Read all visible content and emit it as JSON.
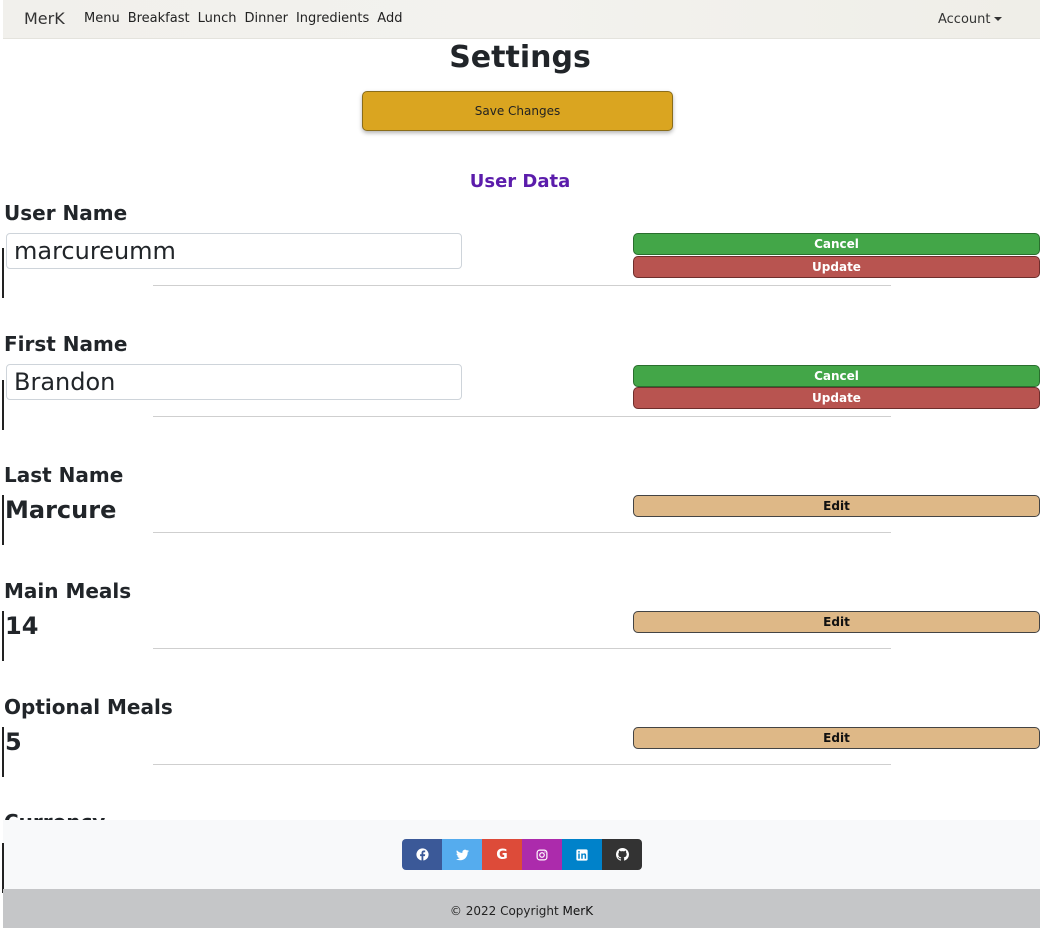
{
  "nav": {
    "brand": "MerK",
    "links": [
      "Menu",
      "Breakfast",
      "Lunch",
      "Dinner",
      "Ingredients",
      "Add"
    ],
    "account": "Account"
  },
  "page": {
    "title": "Settings",
    "save_label": "Save Changes",
    "section_title": "User Data"
  },
  "fields": [
    {
      "label": "User Name",
      "value": "marcureumm",
      "cancel_label": "Cancel",
      "update_label": "Update"
    },
    {
      "label": "First Name",
      "value": "Brandon",
      "cancel_label": "Cancel",
      "update_label": "Update"
    },
    {
      "label": "Last Name",
      "value": "Marcure",
      "edit_label": "Edit"
    },
    {
      "label": "Main Meals",
      "value": "14",
      "edit_label": "Edit"
    },
    {
      "label": "Optional Meals",
      "value": "5",
      "edit_label": "Edit"
    },
    {
      "label": "Currency"
    }
  ],
  "footer": {
    "social": [
      {
        "icon": "facebook-icon",
        "color": "#3b5998"
      },
      {
        "icon": "twitter-icon",
        "color": "#55acee"
      },
      {
        "icon": "google-icon",
        "color": "#dd4b39"
      },
      {
        "icon": "instagram-icon",
        "color": "#ac2bac"
      },
      {
        "icon": "linkedin-icon",
        "color": "#0082ca"
      },
      {
        "icon": "github-icon",
        "color": "#333333"
      }
    ],
    "copyright_prefix": "© 2022 Copyright ",
    "copyright_brand": "MerK"
  },
  "colors": {
    "save": "#daa520",
    "cancel": "#43a648",
    "update": "#b85450",
    "edit": "#deb887",
    "section_title": "#5b1cab"
  }
}
